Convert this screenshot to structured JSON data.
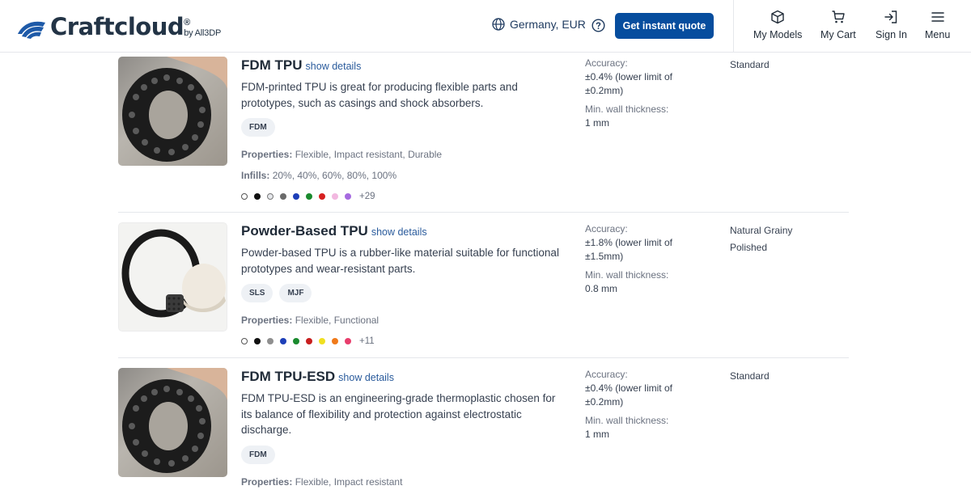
{
  "header": {
    "logo": {
      "name": "Craftcloud",
      "registered": "®",
      "by": "by All3DP"
    },
    "region_label": "Germany, EUR",
    "quote_button": "Get instant quote",
    "nav": [
      {
        "label": "My Models",
        "icon": "cube-icon"
      },
      {
        "label": "My Cart",
        "icon": "cart-icon"
      },
      {
        "label": "Sign In",
        "icon": "sign-in-icon"
      },
      {
        "label": "Menu",
        "icon": "menu-icon"
      }
    ]
  },
  "materials": [
    {
      "title": "FDM TPU",
      "show_details": "show details",
      "description": "FDM-printed TPU is great for producing flexible parts and prototypes, such as casings and shock absorbers.",
      "tags": [
        "FDM"
      ],
      "properties_label": "Properties:",
      "properties": "Flexible, Impact resistant, Durable",
      "infills_label": "Infills:",
      "infills": "20%, 40%, 60%, 80%, 100%",
      "swatches": [
        "#ffffff",
        "#111111",
        "#e5e7eb",
        "#6b6b6b",
        "#1d3fb8",
        "#1a8a2e",
        "#d62020",
        "#f2b8e0",
        "#a66be0"
      ],
      "more_colors": "+29",
      "accuracy_label": "Accuracy:",
      "accuracy": "±0.4% (lower limit of ±0.2mm)",
      "wall_label": "Min. wall thickness:",
      "wall": "1 mm",
      "finishes": [
        "Standard"
      ]
    },
    {
      "title": "Powder-Based TPU",
      "show_details": "show details",
      "description": "Powder-based TPU is a rubber-like material suitable for functional prototypes and wear-resistant parts.",
      "tags": [
        "SLS",
        "MJF"
      ],
      "properties_label": "Properties:",
      "properties": "Flexible, Functional",
      "swatches": [
        "#ffffff",
        "#111111",
        "#8f8f8f",
        "#1d3fb8",
        "#1a8a2e",
        "#c81e1e",
        "#f0e020",
        "#f07a1a",
        "#e83e6c"
      ],
      "more_colors": "+11",
      "accuracy_label": "Accuracy:",
      "accuracy": "±1.8% (lower limit of ±1.5mm)",
      "wall_label": "Min. wall thickness:",
      "wall": "0.8 mm",
      "finishes": [
        "Natural Grainy",
        "Polished"
      ]
    },
    {
      "title": "FDM TPU-ESD",
      "show_details": "show details",
      "description": "FDM TPU-ESD is an engineering-grade thermoplastic chosen for its balance of flexibility and protection against electrostatic discharge.",
      "tags": [
        "FDM"
      ],
      "properties_label": "Properties:",
      "properties": "Flexible, Impact resistant",
      "accuracy_label": "Accuracy:",
      "accuracy": "±0.4% (lower limit of ±0.2mm)",
      "wall_label": "Min. wall thickness:",
      "wall": "1 mm",
      "finishes": [
        "Standard"
      ]
    }
  ]
}
